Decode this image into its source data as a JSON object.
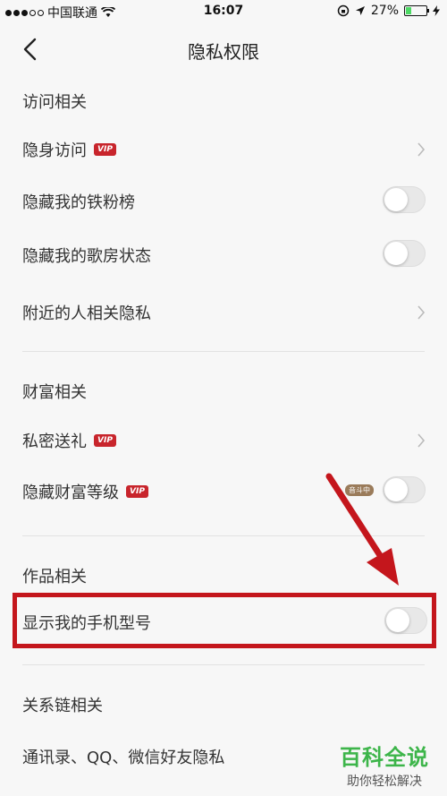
{
  "status_bar": {
    "carrier": "中国联通",
    "time": "16:07",
    "battery": "27%",
    "battery_level": 0.27
  },
  "nav": {
    "title": "隐私权限"
  },
  "sections": {
    "visit": {
      "header": "访问相关",
      "items": [
        {
          "label": "隐身访问",
          "vip": "VIP"
        },
        {
          "label": "隐藏我的铁粉榜"
        },
        {
          "label": "隐藏我的歌房状态"
        },
        {
          "label": "附近的人相关隐私"
        }
      ]
    },
    "wealth": {
      "header": "财富相关",
      "items": [
        {
          "label": "私密送礼",
          "vip": "VIP"
        },
        {
          "label": "隐藏财富等级",
          "vip": "VIP",
          "badge": "音斗中"
        }
      ]
    },
    "works": {
      "header": "作品相关",
      "items": [
        {
          "label": "显示我的手机型号"
        }
      ]
    },
    "relations": {
      "header": "关系链相关",
      "items": [
        {
          "label": "通讯录、QQ、微信好友隐私"
        }
      ]
    }
  },
  "watermark": {
    "main": "百科全说",
    "sub": "助你轻松解决"
  },
  "colors": {
    "vip": "#c8252c",
    "highlight": "#c4161c",
    "toggle_off": "#e8e8e8",
    "watermark_green": "#3db54a"
  }
}
